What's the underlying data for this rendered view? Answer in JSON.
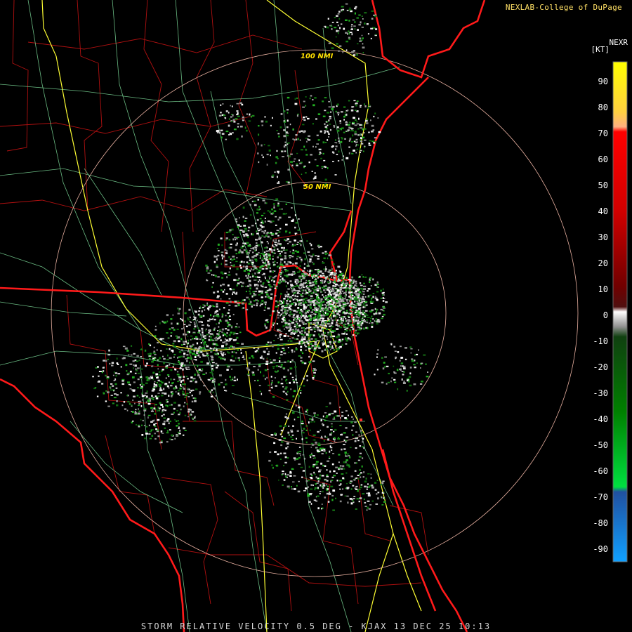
{
  "header": {
    "credit": "NEXLAB-College of DuPage"
  },
  "legend": {
    "product": "NEXR",
    "unit": "[KT]",
    "ticks": [
      "90",
      "80",
      "70",
      "60",
      "50",
      "40",
      "30",
      "20",
      "10",
      "0",
      "-10",
      "-20",
      "-30",
      "-40",
      "-50",
      "-60",
      "-70",
      "-80",
      "-90"
    ]
  },
  "rings": {
    "inner_label": "50 NMI",
    "outer_label": "100 NMI"
  },
  "footer": {
    "caption": "STORM RELATIVE VELOCITY 0.5 DEG - KJAX 13 DEC 25 10:13"
  },
  "colors": {
    "background": "#000000",
    "state_border": "#ff1a1a",
    "county_border": "#b01010",
    "highway": "#ffff33",
    "road": "#7ddc9a",
    "range_ring": "#e8b0a0",
    "label_yellow": "#ffe000"
  }
}
